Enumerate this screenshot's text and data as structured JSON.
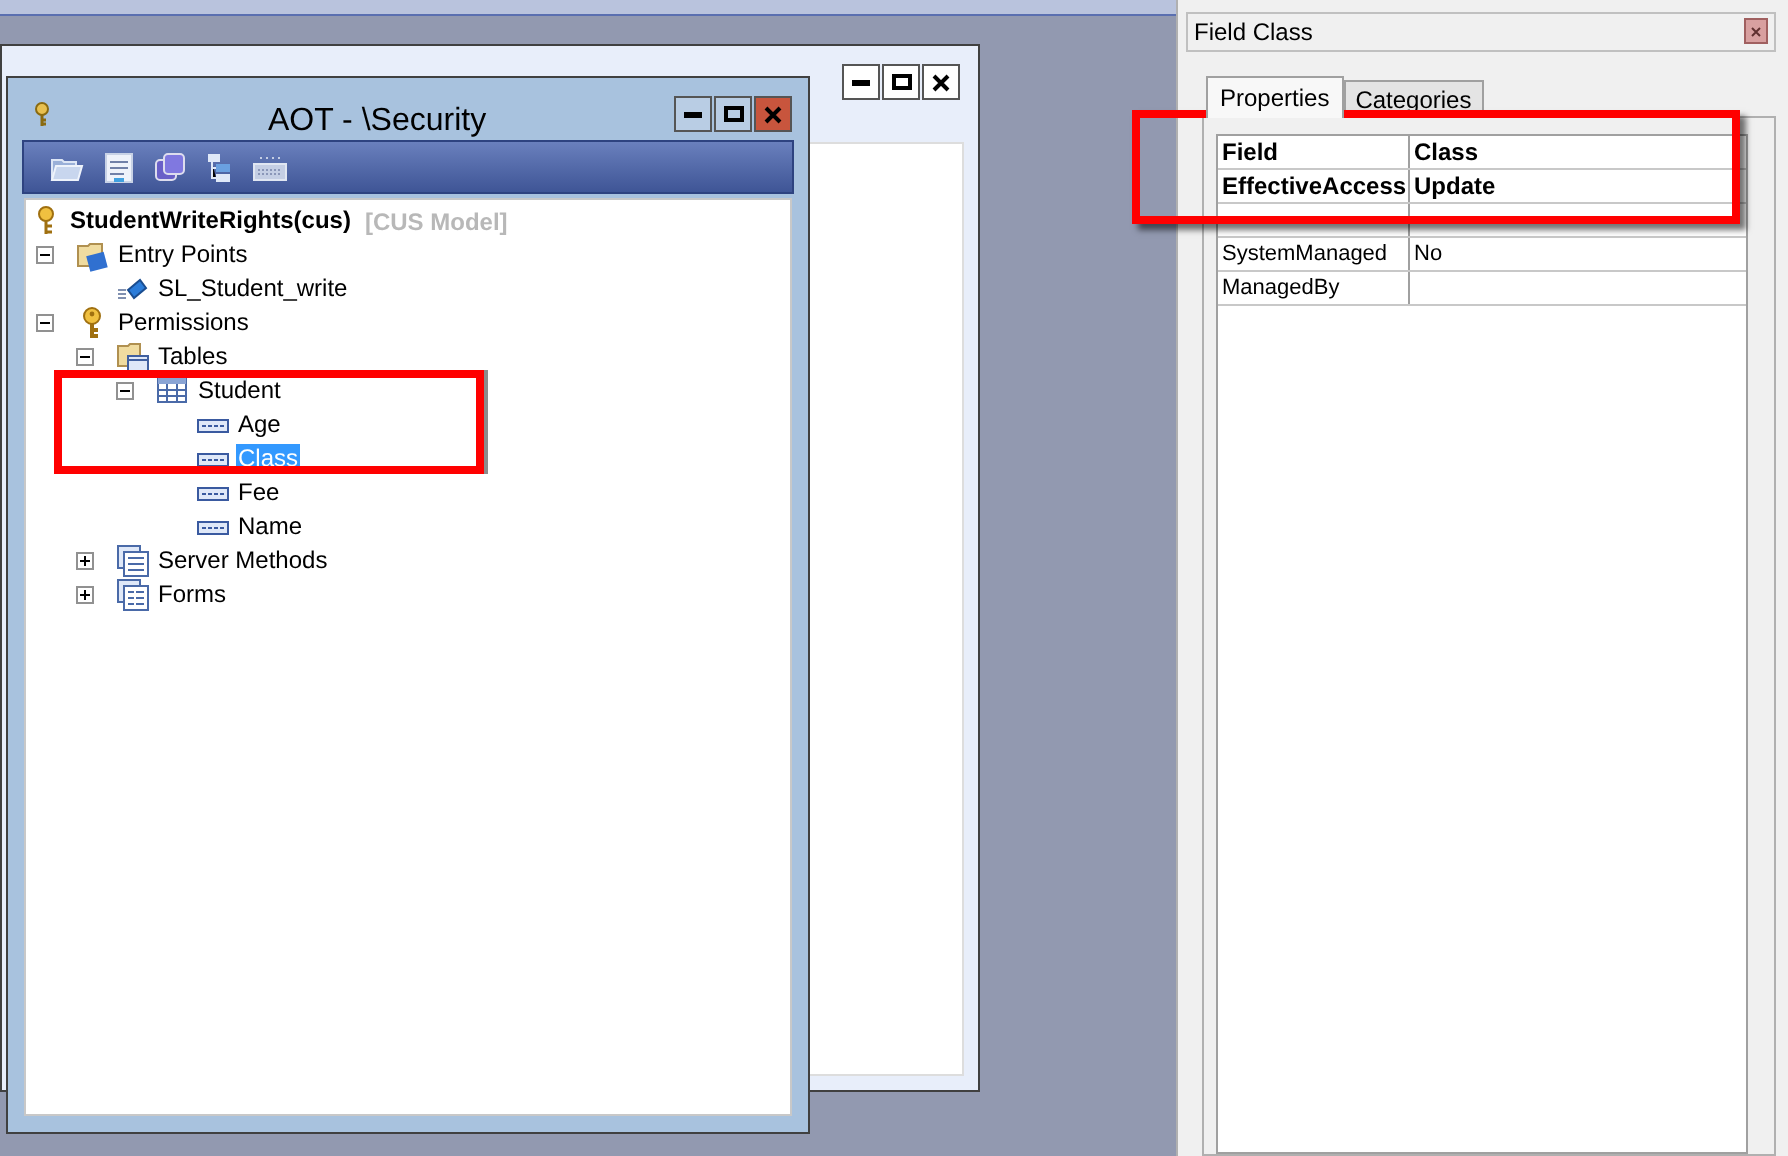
{
  "aot_window": {
    "title": "AOT - \\Security",
    "root": {
      "label": "StudentWriteRights(cus)",
      "annotation": "[CUS Model]",
      "selected": false
    },
    "tree": [
      {
        "label": "Entry Points",
        "kind": "entry-folder",
        "expanded": true,
        "selected": false,
        "children": [
          {
            "label": "SL_Student_write",
            "kind": "entry",
            "selected": false
          }
        ]
      },
      {
        "label": "Permissions",
        "kind": "key",
        "expanded": true,
        "selected": false,
        "children": [
          {
            "label": "Tables",
            "kind": "tables",
            "expanded": true,
            "selected": false,
            "children": [
              {
                "label": "Student",
                "kind": "table",
                "expanded": true,
                "selected": false,
                "children": [
                  {
                    "label": "Age",
                    "kind": "field",
                    "selected": false
                  },
                  {
                    "label": "Class",
                    "kind": "field",
                    "selected": true
                  },
                  {
                    "label": "Fee",
                    "kind": "field",
                    "selected": false
                  },
                  {
                    "label": "Name",
                    "kind": "field",
                    "selected": false
                  }
                ]
              }
            ]
          },
          {
            "label": "Server Methods",
            "kind": "methods",
            "expanded": false,
            "selected": false
          },
          {
            "label": "Forms",
            "kind": "forms",
            "expanded": false,
            "selected": false
          }
        ]
      }
    ]
  },
  "properties_panel": {
    "title": "Field Class",
    "tabs": [
      {
        "label": "Properties",
        "selected": true
      },
      {
        "label": "Categories",
        "selected": false
      }
    ],
    "rows": [
      {
        "name": "Field",
        "value": "Class",
        "kind": "emphasized"
      },
      {
        "name": "EffectiveAccess",
        "value": "Update",
        "kind": "emphasized"
      },
      {
        "kind": "obscured"
      },
      {
        "name": "SystemManaged",
        "value": "No",
        "kind": "plain"
      },
      {
        "name": "ManagedBy",
        "kind": "plain"
      }
    ]
  }
}
